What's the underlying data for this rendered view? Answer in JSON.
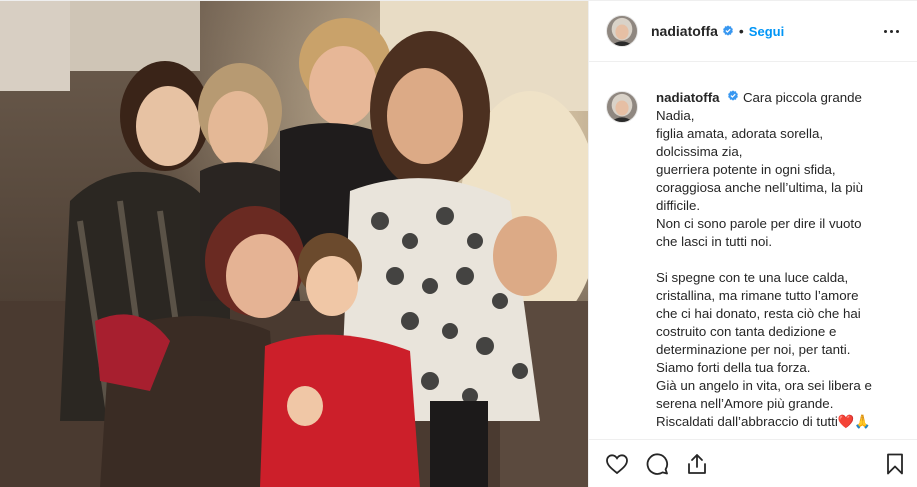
{
  "header": {
    "username": "nadiatoffa",
    "separator": "•",
    "follow_label": "Segui",
    "icons": [
      "verified-badge-icon",
      "more-options-icon"
    ]
  },
  "caption": {
    "username": "nadiatoffa",
    "lines": [
      "Cara piccola grande",
      "Nadia,",
      "figlia amata, adorata sorella,",
      "dolcissima zia,",
      "guerriera potente in ogni sfida,",
      "coraggiosa anche nell’ultima, la più",
      "difficile.",
      "Non ci sono parole per dire il vuoto",
      "che lasci in tutti noi.",
      "",
      "Si spegne con te una luce calda,",
      "cristallina, ma rimane tutto l’amore",
      "che ci hai donato, resta ciò che hai",
      "costruito con tanta dedizione e",
      "determinazione per noi, per tanti.",
      "Siamo forti della tua forza.",
      "Già un angelo in vita, ora sei libera e",
      "serena nell’Amore più grande.",
      "Riscaldati dall’abbraccio di tutti"
    ],
    "emoji_end": "❤️🙏"
  },
  "actions": {
    "icons": [
      "heart-icon",
      "comment-icon",
      "share-icon",
      "bookmark-icon"
    ]
  },
  "colors": {
    "link": "#0095f6",
    "text": "#262626",
    "border": "#efefef",
    "verified": "#3897f0"
  }
}
